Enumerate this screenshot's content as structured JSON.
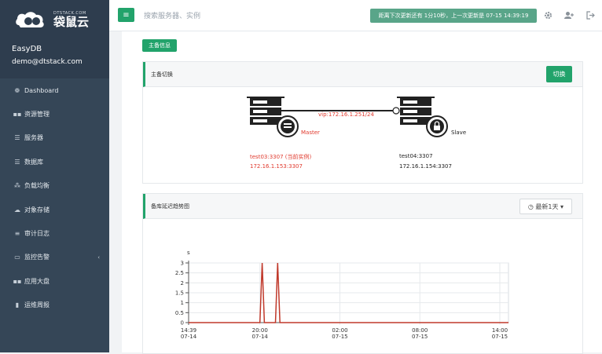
{
  "brand": {
    "small": "DTSTACK.COM",
    "name": "袋鼠云"
  },
  "user": {
    "name": "EasyDB",
    "email": "demo@dtstack.com"
  },
  "nav": [
    {
      "icon": "dashboard-icon",
      "glyph": "❁",
      "label": "Dashboard"
    },
    {
      "icon": "grid-icon",
      "glyph": "▪▪",
      "label": "资源管理"
    },
    {
      "icon": "list-icon",
      "glyph": "☰",
      "label": "服务器"
    },
    {
      "icon": "database-icon",
      "glyph": "☰",
      "label": "数据库"
    },
    {
      "icon": "sitemap-icon",
      "glyph": "⁂",
      "label": "负载均衡"
    },
    {
      "icon": "cloud-icon",
      "glyph": "☁",
      "label": "对象存储"
    },
    {
      "icon": "log-icon",
      "glyph": "≡",
      "label": "审计日志"
    },
    {
      "icon": "monitor-icon",
      "glyph": "▭",
      "label": "监控告警",
      "chevron": "‹"
    },
    {
      "icon": "dashboard-grid-icon",
      "glyph": "▪▪",
      "label": "应用大盘"
    },
    {
      "icon": "report-icon",
      "glyph": "▮",
      "label": "运维周报"
    }
  ],
  "topbar": {
    "menu_glyph": "≡",
    "search_placeholder": "搜索服务器、实例",
    "update_text": "距离下次更新还有 1分10秒，上一次更新是 07-15 14:39:19",
    "icons": [
      "gear-icon",
      "user-add-icon",
      "logout-icon"
    ]
  },
  "content": {
    "tag": "主备信息",
    "failover_panel": {
      "title": "主备切换",
      "button": "切换",
      "vip": "vip:172.16.1.251/24",
      "master": {
        "role": "Master",
        "instance": "test03:3307 (当前实例)",
        "address": "172.16.1.153:3307"
      },
      "slave": {
        "role": "Slave",
        "instance": "test04:3307",
        "address": "172.16.1.154:3307"
      }
    },
    "delay_panel": {
      "title": "备库延迟趋势图",
      "range_button": "◷ 最新1天 ▾"
    }
  },
  "colors": {
    "accent": "#22a36b",
    "sidebar": "#2e3d4e",
    "alert_red": "#e03a2e",
    "banner": "#59a589"
  },
  "chart_data": {
    "type": "line",
    "ylabel": "s",
    "ylim": [
      0,
      3
    ],
    "y_ticks": [
      "3",
      "2.5",
      "2",
      "1.5",
      "1",
      "0.5",
      "0"
    ],
    "x_ticks": [
      {
        "time": "14:39",
        "date": "07-14"
      },
      {
        "time": "20:00",
        "date": "07-14"
      },
      {
        "time": "02:00",
        "date": "07-15"
      },
      {
        "time": "08:00",
        "date": "07-15"
      },
      {
        "time": "14:00",
        "date": "07-15"
      }
    ],
    "series": [
      {
        "color": "#c0392b",
        "points": [
          {
            "x": "07-14 14:39",
            "y": 0
          },
          {
            "x": "07-14 20:00",
            "y": 0
          },
          {
            "x": "07-14 20:10",
            "y": 3
          },
          {
            "x": "07-14 20:20",
            "y": 0
          },
          {
            "x": "07-14 21:10",
            "y": 0
          },
          {
            "x": "07-14 21:20",
            "y": 3
          },
          {
            "x": "07-14 21:30",
            "y": 0
          },
          {
            "x": "07-15 14:39",
            "y": 0
          }
        ]
      }
    ]
  }
}
